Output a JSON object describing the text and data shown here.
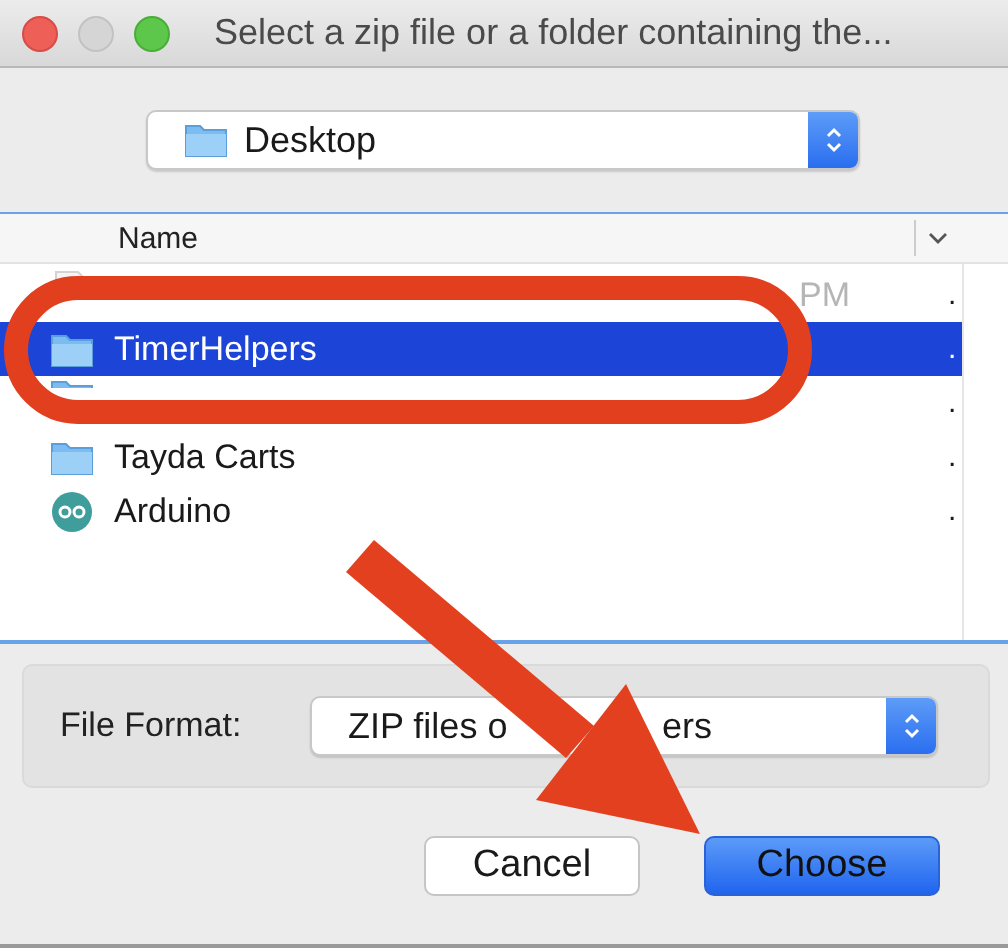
{
  "window": {
    "title": "Select a zip file or a folder containing the..."
  },
  "location": {
    "value": "Desktop"
  },
  "list": {
    "columns": [
      {
        "label": "Name"
      }
    ],
    "rows": [
      {
        "kind": "file",
        "name_tail": "PM",
        "column_2": ".",
        "selected": false,
        "disabled": true
      },
      {
        "kind": "folder",
        "name": "TimerHelpers",
        "column_2": ".",
        "selected": true,
        "disabled": false
      },
      {
        "kind": "folder",
        "column_2": ".",
        "selected": false,
        "disabled": false
      },
      {
        "kind": "folder",
        "name": "Tayda Carts",
        "column_2": ".",
        "selected": false,
        "disabled": false
      },
      {
        "kind": "app",
        "name": "Arduino",
        "column_2": ".",
        "selected": false,
        "disabled": false
      }
    ]
  },
  "file_format": {
    "label": "File Format:",
    "value": "ZIP files o",
    "value_tail": "ers"
  },
  "buttons": [
    {
      "label": "Cancel",
      "kind": "default"
    },
    {
      "label": "Choose",
      "kind": "primary"
    }
  ],
  "annotations": {
    "ring": true,
    "arrow": true
  }
}
